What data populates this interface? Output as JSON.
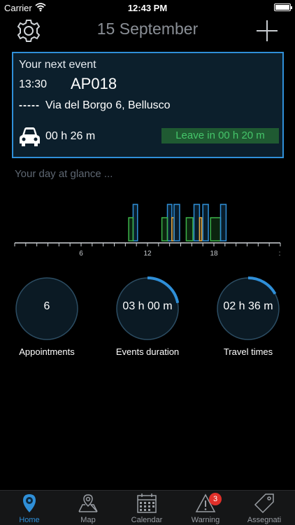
{
  "status_bar": {
    "carrier": "Carrier",
    "time": "12:43 PM"
  },
  "header": {
    "title": "15 September"
  },
  "next_event": {
    "label": "Your next event",
    "time": "13:30",
    "code": "AP018",
    "dashes": "-----",
    "address": "Via del Borgo 6, Bellusco",
    "travel_time": "00 h 26 m",
    "leave_in": "Leave in 00 h 20 m"
  },
  "glance": {
    "label": "Your day at glance ..."
  },
  "chart_data": {
    "type": "bar",
    "x_axis_ticks": [
      "6",
      "12",
      "18",
      ":"
    ],
    "x_range_hours": [
      0,
      24
    ],
    "blocks": [
      {
        "color": "#2f8fd8",
        "start": 10.7,
        "end": 11.1,
        "level": "high"
      },
      {
        "color": "#3cb44a",
        "start": 10.3,
        "end": 10.7,
        "level": "low"
      },
      {
        "color": "#2f8fd8",
        "start": 13.8,
        "end": 14.2,
        "level": "high"
      },
      {
        "color": "#3cb44a",
        "start": 13.3,
        "end": 13.8,
        "level": "low"
      },
      {
        "color": "#e8a53a",
        "start": 14.2,
        "end": 14.4,
        "level": "low"
      },
      {
        "color": "#2f8fd8",
        "start": 14.4,
        "end": 14.9,
        "level": "high"
      },
      {
        "color": "#3cb44a",
        "start": 15.5,
        "end": 16.1,
        "level": "low"
      },
      {
        "color": "#2f8fd8",
        "start": 16.2,
        "end": 16.7,
        "level": "high"
      },
      {
        "color": "#e8a53a",
        "start": 16.7,
        "end": 16.9,
        "level": "low"
      },
      {
        "color": "#2f8fd8",
        "start": 17.0,
        "end": 17.5,
        "level": "high"
      },
      {
        "color": "#3cb44a",
        "start": 17.7,
        "end": 18.6,
        "level": "low"
      },
      {
        "color": "#2f8fd8",
        "start": 18.6,
        "end": 19.1,
        "level": "high"
      }
    ]
  },
  "stats": [
    {
      "value": "6",
      "label": "Appointments",
      "progress": 0.0
    },
    {
      "value": "03 h 00 m",
      "label": "Events duration",
      "progress": 0.22
    },
    {
      "value": "02 h 36 m",
      "label": "Travel times",
      "progress": 0.17
    }
  ],
  "tabs": [
    {
      "label": "Home",
      "icon": "home-pin-icon",
      "active": true
    },
    {
      "label": "Map",
      "icon": "map-icon",
      "active": false
    },
    {
      "label": "Calendar",
      "icon": "calendar-icon",
      "active": false
    },
    {
      "label": "Warning",
      "icon": "warning-icon",
      "active": false,
      "badge": "3"
    },
    {
      "label": "Assegnati",
      "icon": "tag-icon",
      "active": false
    }
  ],
  "colors": {
    "accent": "#2f8fd8",
    "green": "#3cb44a",
    "orange": "#e8a53a",
    "badge": "#e0302a"
  }
}
